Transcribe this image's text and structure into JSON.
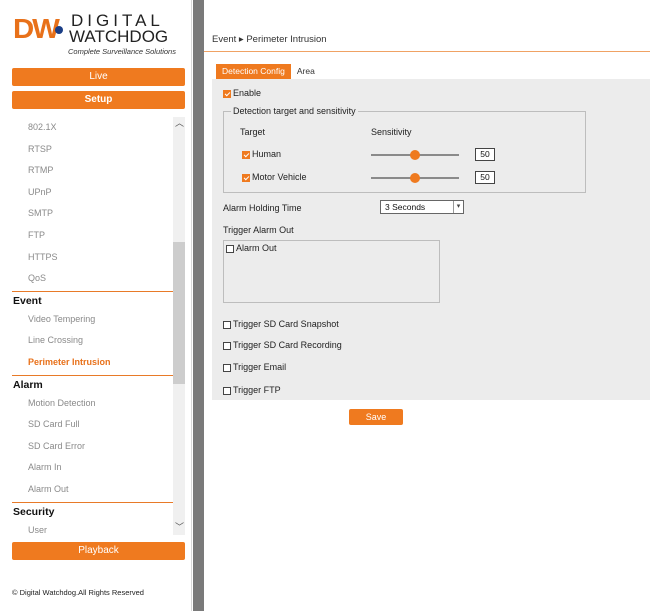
{
  "logo": {
    "brand_initials": "DW",
    "brand_line1": "DIGITAL",
    "brand_line2": "WATCHDOG",
    "tagline": "Complete Surveillance Solutions",
    "accent_color": "#E8711A"
  },
  "sidebar": {
    "live_label": "Live",
    "setup_label": "Setup",
    "playback_label": "Playback",
    "menu": [
      {
        "type": "item",
        "label": "802.1X"
      },
      {
        "type": "item",
        "label": "RTSP"
      },
      {
        "type": "item",
        "label": "RTMP"
      },
      {
        "type": "item",
        "label": "UPnP"
      },
      {
        "type": "item",
        "label": "SMTP"
      },
      {
        "type": "item",
        "label": "FTP"
      },
      {
        "type": "item",
        "label": "HTTPS"
      },
      {
        "type": "item",
        "label": "QoS"
      },
      {
        "type": "head",
        "label": "Event"
      },
      {
        "type": "item",
        "label": "Video Tempering"
      },
      {
        "type": "item",
        "label": "Line Crossing"
      },
      {
        "type": "item",
        "label": "Perimeter Intrusion",
        "active": true
      },
      {
        "type": "head",
        "label": "Alarm"
      },
      {
        "type": "item",
        "label": "Motion Detection"
      },
      {
        "type": "item",
        "label": "SD Card Full"
      },
      {
        "type": "item",
        "label": "SD Card Error"
      },
      {
        "type": "item",
        "label": "Alarm In"
      },
      {
        "type": "item",
        "label": "Alarm Out"
      },
      {
        "type": "head",
        "label": "Security"
      },
      {
        "type": "item",
        "label": "User"
      }
    ],
    "copyright": "© Digital Watchdog.All Rights Reserved"
  },
  "main": {
    "breadcrumb": "Event ▸ Perimeter Intrusion",
    "tabs": [
      {
        "label": "Detection Config",
        "active": true
      },
      {
        "label": "Area",
        "active": false
      }
    ],
    "enable": {
      "label": "Enable",
      "checked": true
    },
    "detection": {
      "legend": "Detection target and sensitivity",
      "col_target": "Target",
      "col_sensitivity": "Sensitivity",
      "targets": [
        {
          "label": "Human",
          "checked": true,
          "sensitivity": 50,
          "sensitivity_text": "50"
        },
        {
          "label": "Motor Vehicle",
          "checked": true,
          "sensitivity": 50,
          "sensitivity_text": "50"
        }
      ]
    },
    "alarm_holding": {
      "label": "Alarm Holding Time",
      "value": "3 Seconds"
    },
    "trigger_alarm_out": {
      "label": "Trigger Alarm Out",
      "items": [
        {
          "label": "Alarm Out",
          "checked": false
        }
      ]
    },
    "triggers": [
      {
        "label": "Trigger SD Card Snapshot",
        "checked": false
      },
      {
        "label": "Trigger SD Card Recording",
        "checked": false
      },
      {
        "label": "Trigger Email",
        "checked": false
      },
      {
        "label": "Trigger FTP",
        "checked": false
      }
    ],
    "save_label": "Save"
  }
}
